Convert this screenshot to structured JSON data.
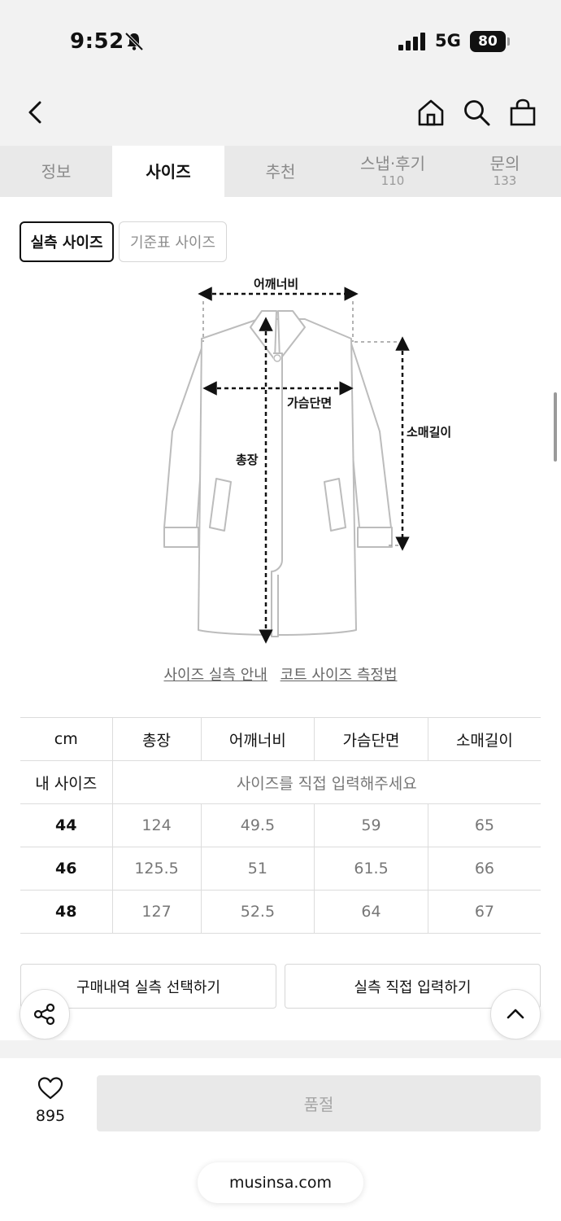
{
  "status_bar": {
    "time": "9:52",
    "network": "5G",
    "battery": "80"
  },
  "tabs": [
    {
      "label": "정보",
      "count": ""
    },
    {
      "label": "사이즈",
      "count": ""
    },
    {
      "label": "추천",
      "count": ""
    },
    {
      "label": "스냅·후기",
      "count": "110"
    },
    {
      "label": "문의",
      "count": "133"
    }
  ],
  "size_toggle": {
    "measured": "실측 사이즈",
    "standard": "기준표 사이즈"
  },
  "diagram": {
    "shoulder_label": "어깨너비",
    "chest_label": "가슴단면",
    "length_label": "총장",
    "sleeve_label": "소매길이"
  },
  "guide_links": {
    "size_guide": "사이즈 실측 안내",
    "coat_measure": "코트 사이즈 측정법"
  },
  "table": {
    "unit": "cm",
    "headers": [
      "총장",
      "어깨너비",
      "가슴단면",
      "소매길이"
    ],
    "my_size_label": "내 사이즈",
    "my_size_prompt": "사이즈를 직접 입력해주세요",
    "rows": [
      {
        "size": "44",
        "values": [
          "124",
          "49.5",
          "59",
          "65"
        ]
      },
      {
        "size": "46",
        "values": [
          "125.5",
          "51",
          "61.5",
          "66"
        ]
      },
      {
        "size": "48",
        "values": [
          "127",
          "52.5",
          "64",
          "67"
        ]
      }
    ]
  },
  "actions": {
    "select_history": "구매내역 실측 선택하기",
    "direct_input": "실측 직접 입력하기"
  },
  "bottom_bar": {
    "like_count": "895",
    "soldout_label": "품절"
  },
  "url": "musinsa.com"
}
